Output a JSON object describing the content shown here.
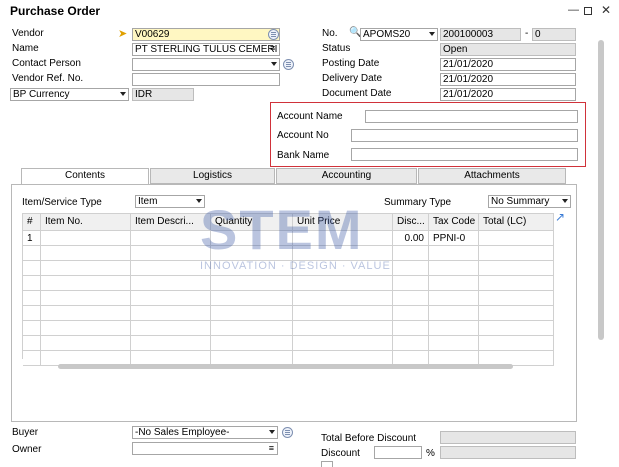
{
  "window": {
    "title": "Purchase Order"
  },
  "header_left": {
    "vendor_label": "Vendor",
    "vendor_value": "V00629",
    "name_label": "Name",
    "name_value": "PT STERLING TULUS CEMERI",
    "contact_label": "Contact Person",
    "vendor_ref_label": "Vendor Ref. No.",
    "currency_select": "BP Currency",
    "currency_value": "IDR"
  },
  "header_right": {
    "no_label": "No.",
    "series_value": "APOMS20",
    "doc_number": "200100003",
    "doc_suffix": "0",
    "dash": "-",
    "status_label": "Status",
    "status_value": "Open",
    "posting_label": "Posting Date",
    "posting_value": "21/01/2020",
    "delivery_label": "Delivery Date",
    "delivery_value": "21/01/2020",
    "document_label": "Document Date",
    "document_value": "21/01/2020"
  },
  "account_box": {
    "account_name_label": "Account Name",
    "account_no_label": "Account No",
    "bank_name_label": "Bank Name"
  },
  "tabs": [
    "Contents",
    "Logistics",
    "Accounting",
    "Attachments"
  ],
  "contents": {
    "item_type_label": "Item/Service Type",
    "item_type_value": "Item",
    "summary_type_label": "Summary Type",
    "summary_type_value": "No Summary"
  },
  "table": {
    "columns": [
      "#",
      "Item No.",
      "Item Descri...",
      "Quantity",
      "Unit Price",
      "Disc...",
      "Tax Code",
      "Total (LC)"
    ],
    "rows": [
      [
        "1",
        "",
        "",
        "",
        "",
        "0.00",
        "PPNI-0",
        ""
      ]
    ]
  },
  "watermark": {
    "main": "STEM",
    "tagline": "INNOVATION · DESIGN · VALUE"
  },
  "footer": {
    "buyer_label": "Buyer",
    "buyer_value": "-No Sales Employee-",
    "owner_label": "Owner",
    "total_before_label": "Total Before Discount",
    "discount_label": "Discount",
    "percent": "%"
  },
  "colors": {
    "account_box_border": "#d0323a",
    "tab_bg": "#e9e9e9",
    "grid_line": "#d0d0d0",
    "yellow_field": "#fff7c2"
  },
  "icons": [
    "minimize-icon",
    "maximize-icon",
    "close-icon",
    "link-arrow-icon",
    "search-icon",
    "list-icon",
    "expand-icon"
  ]
}
